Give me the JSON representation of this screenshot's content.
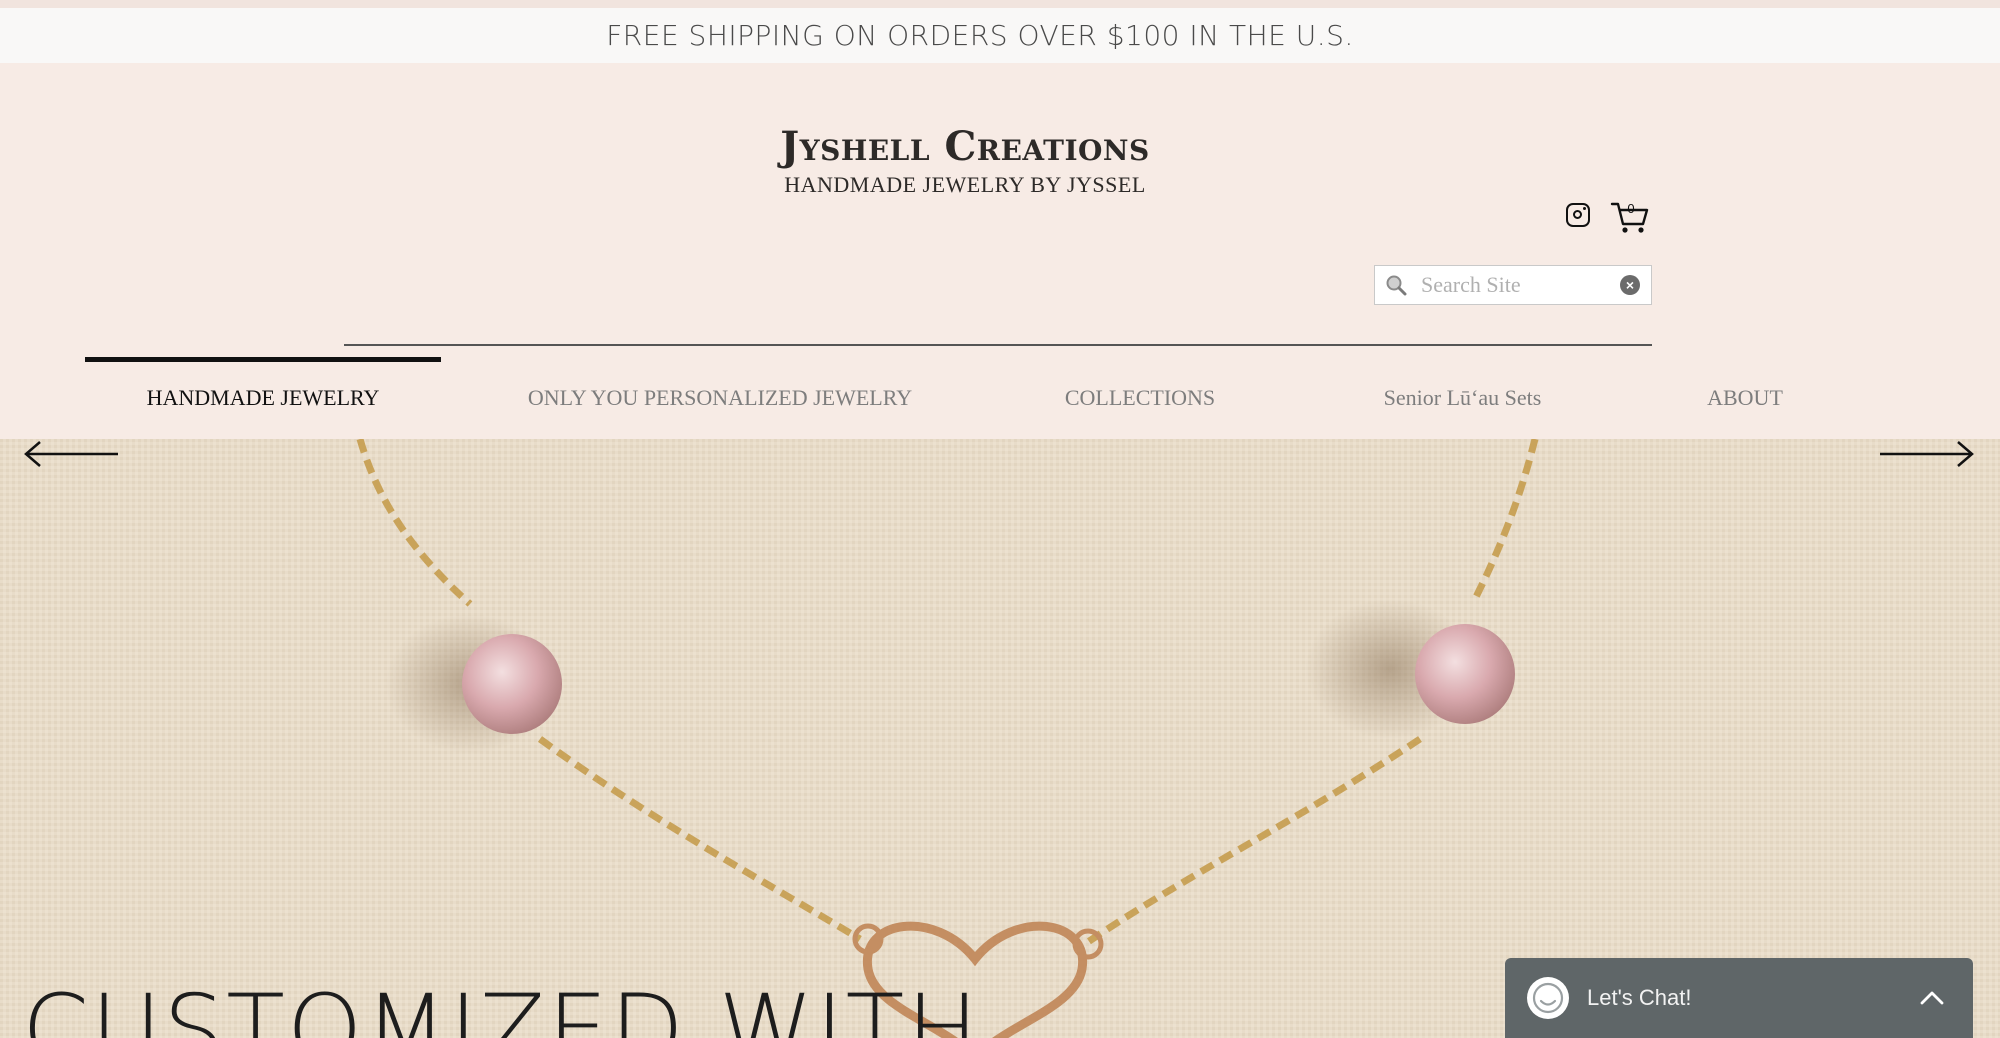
{
  "announcement": {
    "text": "FREE SHIPPING ON ORDERS OVER $100 IN THE U.S."
  },
  "brand": {
    "title": "Jyshell Creations",
    "subtitle": "HANDMADE JEWELRY BY JYSSEL"
  },
  "header": {
    "cart_count": "0",
    "icons": [
      "instagram-icon",
      "cart-icon"
    ]
  },
  "search": {
    "placeholder": "Search Site",
    "value": ""
  },
  "nav": {
    "items": [
      {
        "label": "HANDMADE JEWELRY",
        "active": true
      },
      {
        "label": "ONLY YOU PERSONALIZED JEWELRY",
        "active": false
      },
      {
        "label": "COLLECTIONS",
        "active": false
      },
      {
        "label": "Senior Lūʻau Sets",
        "active": false
      },
      {
        "label": "ABOUT",
        "active": false
      }
    ]
  },
  "hero": {
    "title": "CUSTOMIZED WITH"
  },
  "chat": {
    "label": "Let's Chat!"
  },
  "colors": {
    "header_bg": "#f7ebe5",
    "announcement_bg": "#f9f8f7",
    "chat_bg": "#5f6668",
    "text_dark": "#111111",
    "nav_muted": "#7d7d7d"
  }
}
